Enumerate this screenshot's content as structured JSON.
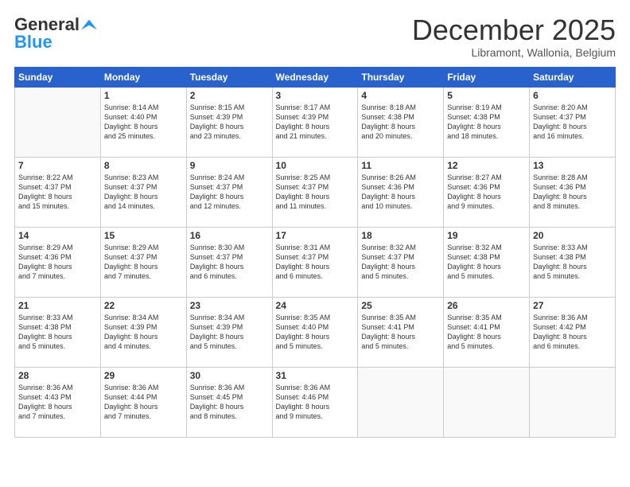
{
  "header": {
    "logo_general": "General",
    "logo_blue": "Blue",
    "month_title": "December 2025",
    "location": "Libramont, Wallonia, Belgium"
  },
  "weekdays": [
    "Sunday",
    "Monday",
    "Tuesday",
    "Wednesday",
    "Thursday",
    "Friday",
    "Saturday"
  ],
  "weeks": [
    [
      {
        "day": "",
        "info": ""
      },
      {
        "day": "1",
        "info": "Sunrise: 8:14 AM\nSunset: 4:40 PM\nDaylight: 8 hours\nand 25 minutes."
      },
      {
        "day": "2",
        "info": "Sunrise: 8:15 AM\nSunset: 4:39 PM\nDaylight: 8 hours\nand 23 minutes."
      },
      {
        "day": "3",
        "info": "Sunrise: 8:17 AM\nSunset: 4:39 PM\nDaylight: 8 hours\nand 21 minutes."
      },
      {
        "day": "4",
        "info": "Sunrise: 8:18 AM\nSunset: 4:38 PM\nDaylight: 8 hours\nand 20 minutes."
      },
      {
        "day": "5",
        "info": "Sunrise: 8:19 AM\nSunset: 4:38 PM\nDaylight: 8 hours\nand 18 minutes."
      },
      {
        "day": "6",
        "info": "Sunrise: 8:20 AM\nSunset: 4:37 PM\nDaylight: 8 hours\nand 16 minutes."
      }
    ],
    [
      {
        "day": "7",
        "info": "Sunrise: 8:22 AM\nSunset: 4:37 PM\nDaylight: 8 hours\nand 15 minutes."
      },
      {
        "day": "8",
        "info": "Sunrise: 8:23 AM\nSunset: 4:37 PM\nDaylight: 8 hours\nand 14 minutes."
      },
      {
        "day": "9",
        "info": "Sunrise: 8:24 AM\nSunset: 4:37 PM\nDaylight: 8 hours\nand 12 minutes."
      },
      {
        "day": "10",
        "info": "Sunrise: 8:25 AM\nSunset: 4:37 PM\nDaylight: 8 hours\nand 11 minutes."
      },
      {
        "day": "11",
        "info": "Sunrise: 8:26 AM\nSunset: 4:36 PM\nDaylight: 8 hours\nand 10 minutes."
      },
      {
        "day": "12",
        "info": "Sunrise: 8:27 AM\nSunset: 4:36 PM\nDaylight: 8 hours\nand 9 minutes."
      },
      {
        "day": "13",
        "info": "Sunrise: 8:28 AM\nSunset: 4:36 PM\nDaylight: 8 hours\nand 8 minutes."
      }
    ],
    [
      {
        "day": "14",
        "info": "Sunrise: 8:29 AM\nSunset: 4:36 PM\nDaylight: 8 hours\nand 7 minutes."
      },
      {
        "day": "15",
        "info": "Sunrise: 8:29 AM\nSunset: 4:37 PM\nDaylight: 8 hours\nand 7 minutes."
      },
      {
        "day": "16",
        "info": "Sunrise: 8:30 AM\nSunset: 4:37 PM\nDaylight: 8 hours\nand 6 minutes."
      },
      {
        "day": "17",
        "info": "Sunrise: 8:31 AM\nSunset: 4:37 PM\nDaylight: 8 hours\nand 6 minutes."
      },
      {
        "day": "18",
        "info": "Sunrise: 8:32 AM\nSunset: 4:37 PM\nDaylight: 8 hours\nand 5 minutes."
      },
      {
        "day": "19",
        "info": "Sunrise: 8:32 AM\nSunset: 4:38 PM\nDaylight: 8 hours\nand 5 minutes."
      },
      {
        "day": "20",
        "info": "Sunrise: 8:33 AM\nSunset: 4:38 PM\nDaylight: 8 hours\nand 5 minutes."
      }
    ],
    [
      {
        "day": "21",
        "info": "Sunrise: 8:33 AM\nSunset: 4:38 PM\nDaylight: 8 hours\nand 5 minutes."
      },
      {
        "day": "22",
        "info": "Sunrise: 8:34 AM\nSunset: 4:39 PM\nDaylight: 8 hours\nand 4 minutes."
      },
      {
        "day": "23",
        "info": "Sunrise: 8:34 AM\nSunset: 4:39 PM\nDaylight: 8 hours\nand 5 minutes."
      },
      {
        "day": "24",
        "info": "Sunrise: 8:35 AM\nSunset: 4:40 PM\nDaylight: 8 hours\nand 5 minutes."
      },
      {
        "day": "25",
        "info": "Sunrise: 8:35 AM\nSunset: 4:41 PM\nDaylight: 8 hours\nand 5 minutes."
      },
      {
        "day": "26",
        "info": "Sunrise: 8:35 AM\nSunset: 4:41 PM\nDaylight: 8 hours\nand 5 minutes."
      },
      {
        "day": "27",
        "info": "Sunrise: 8:36 AM\nSunset: 4:42 PM\nDaylight: 8 hours\nand 6 minutes."
      }
    ],
    [
      {
        "day": "28",
        "info": "Sunrise: 8:36 AM\nSunset: 4:43 PM\nDaylight: 8 hours\nand 7 minutes."
      },
      {
        "day": "29",
        "info": "Sunrise: 8:36 AM\nSunset: 4:44 PM\nDaylight: 8 hours\nand 7 minutes."
      },
      {
        "day": "30",
        "info": "Sunrise: 8:36 AM\nSunset: 4:45 PM\nDaylight: 8 hours\nand 8 minutes."
      },
      {
        "day": "31",
        "info": "Sunrise: 8:36 AM\nSunset: 4:46 PM\nDaylight: 8 hours\nand 9 minutes."
      },
      {
        "day": "",
        "info": ""
      },
      {
        "day": "",
        "info": ""
      },
      {
        "day": "",
        "info": ""
      }
    ]
  ]
}
